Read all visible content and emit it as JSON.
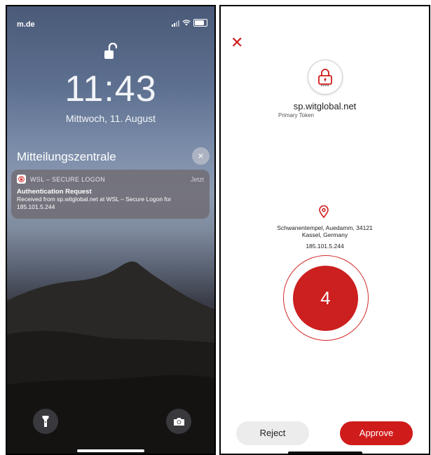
{
  "lock_screen": {
    "carrier": "m.de",
    "time": "11:43",
    "date": "Mittwoch, 11. August",
    "notification_center_title": "Mitteilungszentrale",
    "close_icon": "×",
    "notification": {
      "app_name": "WSL – SECURE LOGON",
      "time": "Jetzt",
      "title": "Authentication Request",
      "body": "Received from sp.witglobal.net at WSL – Secure Logon for 185.101.5.244"
    },
    "icons": [
      "unlock-icon",
      "flashlight-icon",
      "camera-icon",
      "wifi-icon",
      "battery-icon",
      "signal-icon"
    ]
  },
  "auth_screen": {
    "close_icon": "✕",
    "domain": "sp.witglobal.net",
    "token_name": "Primary Token",
    "address_line1": "Schwanentempel, Auedamm, 34121",
    "address_line2": "Kassel, Germany",
    "ip": "185.101.5.244",
    "code": "4",
    "reject_label": "Reject",
    "approve_label": "Approve",
    "accent_color": "#d01b1b"
  }
}
